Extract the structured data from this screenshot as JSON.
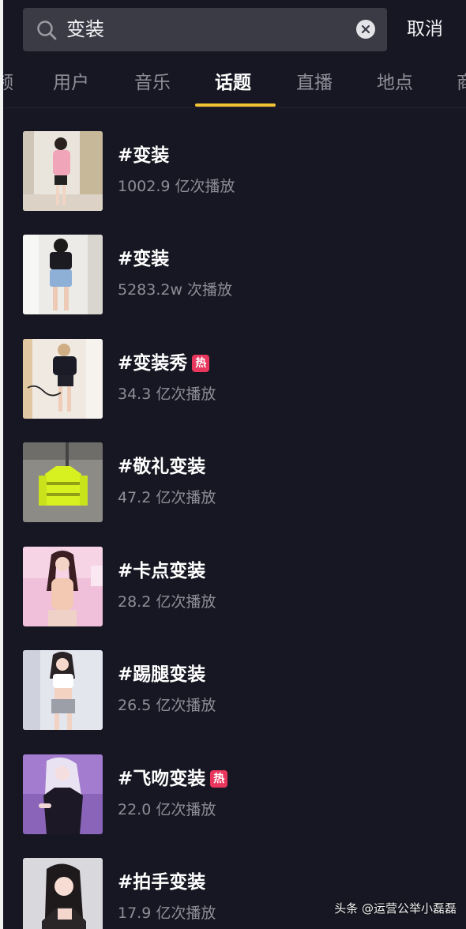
{
  "search": {
    "query": "变装",
    "cancel_label": "取消"
  },
  "tabs": [
    {
      "label": "频",
      "active": false
    },
    {
      "label": "用户",
      "active": false
    },
    {
      "label": "音乐",
      "active": false
    },
    {
      "label": "话题",
      "active": true
    },
    {
      "label": "直播",
      "active": false
    },
    {
      "label": "地点",
      "active": false
    },
    {
      "label": "商",
      "active": false
    }
  ],
  "topics": [
    {
      "title": "#变装",
      "hot": false,
      "stats": "1002.9 亿次播放"
    },
    {
      "title": "#变装",
      "hot": false,
      "stats": "5283.2w 次播放"
    },
    {
      "title": "#变装秀",
      "hot": true,
      "stats": "34.3 亿次播放"
    },
    {
      "title": "#敬礼变装",
      "hot": false,
      "stats": "47.2 亿次播放"
    },
    {
      "title": "#卡点变装",
      "hot": false,
      "stats": "28.2 亿次播放"
    },
    {
      "title": "#踢腿变装",
      "hot": false,
      "stats": "26.5 亿次播放"
    },
    {
      "title": "#飞吻变装",
      "hot": true,
      "stats": "22.0 亿次播放"
    },
    {
      "title": "#拍手变装",
      "hot": false,
      "stats": "17.9 亿次播放"
    }
  ],
  "hot_badge_label": "热",
  "watermark": "头条 @运营公举小磊磊",
  "colors": {
    "background": "#161722",
    "search_bg": "#3a3b45",
    "tab_indicator": "#f3c235",
    "hot_badge": "#e8365d",
    "muted_text": "#8d8e97"
  },
  "icons": {
    "search": "search-icon",
    "clear": "clear-icon"
  }
}
